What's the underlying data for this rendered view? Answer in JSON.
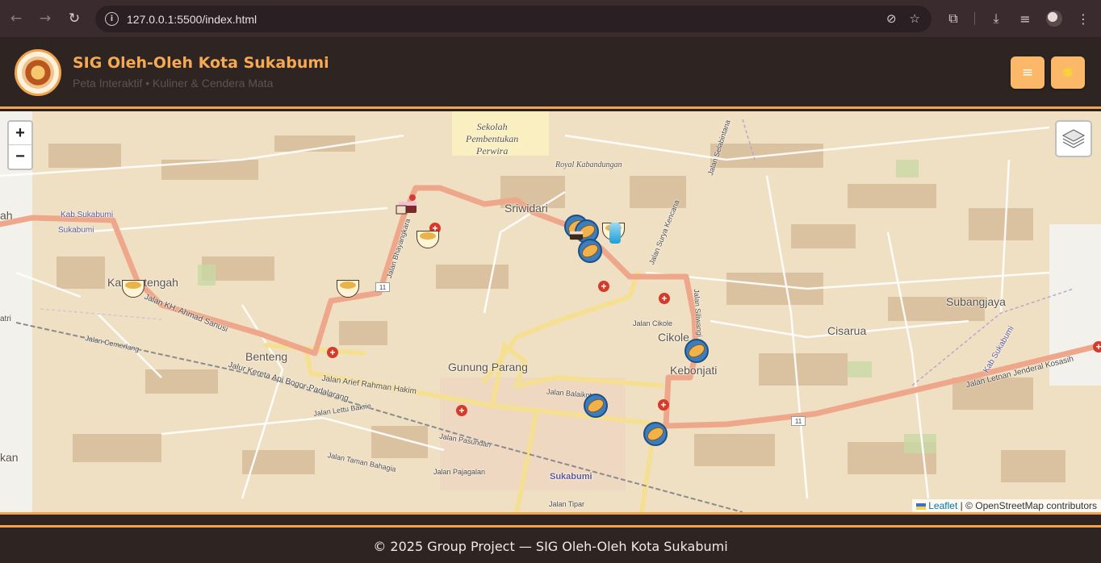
{
  "browser": {
    "url": "127.0.0.1:5500/index.html"
  },
  "header": {
    "title": "SIG Oleh-Oleh Kota Sukabumi",
    "subtitle": "Peta Interaktif • Kuliner & Cendera Mata",
    "menu_icon": "hamburger-icon",
    "theme_icon": "sun-icon"
  },
  "map": {
    "zoom_in": "+",
    "zoom_out": "−",
    "attribution_leaflet": "Leaflet",
    "attribution_rest": "| © OpenStreetMap contributors",
    "labels": {
      "sekolah": "Sekolah\nPembentukan\nPerwira",
      "royal": "Royal Kabandungan",
      "sriwidari": "Sriwidari",
      "karangtengah": "Karangtengah",
      "benteng": "Benteng",
      "gunung_parang": "Gunung Parang",
      "cikole": "Cikole",
      "kebonjati": "Kebonjati",
      "cisarua": "Cisarua",
      "subangjaya": "Subangjaya",
      "sukabumi": "Sukabumi",
      "kab_sukabumi_w": "Kab Sukabumi",
      "sukabumi_w": "Sukabumi",
      "kab_sukabumi_e": "Kab Sukabumi",
      "jalan_arief": "Jalan Arief Rahman Hakim",
      "jalan_letjen": "Jalan Letnan Jenderal Kosasih",
      "jalan_kh": "Jalan KH. Ahmad Sanusi",
      "jalan_bhayangkara": "Jalan Bhayangkara",
      "jalan_siliwangi": "Jalan Siliwangi",
      "jalan_cikole": "Jalan Cikole",
      "jalan_lettu": "Jalan Lettu Bakrie",
      "jalan_pasundan": "Jalan Pasundan",
      "jalan_pajagalan": "Jalan Pajagalan",
      "jalan_taman_bahagia": "Jalan Taman Bahagia",
      "jalan_tipar": "Jalan Tipar",
      "jalan_cemerlang": "Jalan Cemerlang",
      "jalur_kereta": "Jalur Kereta Api Bogor-Padalarang",
      "jalan_balaikota": "Jalan Balaikota",
      "jalan_surya": "Jalan Surya Kencana",
      "jalan_selabintana": "Jalan Selabintana",
      "kan": "kan",
      "ah": "ah",
      "atri": "atri",
      "route11a": "11",
      "route11b": "11"
    }
  }
}
